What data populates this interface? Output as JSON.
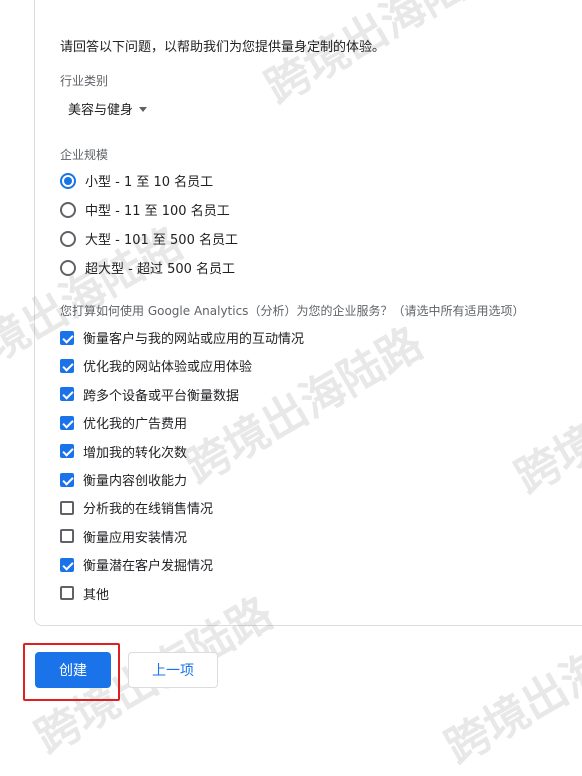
{
  "intro": "请回答以下问题，以帮助我们为您提供量身定制的体验。",
  "industry": {
    "label": "行业类别",
    "value": "美容与健身"
  },
  "size": {
    "label": "企业规模",
    "options": [
      {
        "text": "小型 - 1 至 10 名员工",
        "selected": true
      },
      {
        "text": "中型 - 11 至 100 名员工",
        "selected": false
      },
      {
        "text": "大型 - 101 至 500 名员工",
        "selected": false
      },
      {
        "text": "超大型 - 超过 500 名员工",
        "selected": false
      }
    ]
  },
  "usage": {
    "label": "您打算如何使用 Google Analytics（分析）为您的企业服务？（请选中所有适用选项）",
    "options": [
      {
        "text": "衡量客户与我的网站或应用的互动情况",
        "checked": true
      },
      {
        "text": "优化我的网站体验或应用体验",
        "checked": true
      },
      {
        "text": "跨多个设备或平台衡量数据",
        "checked": true
      },
      {
        "text": "优化我的广告费用",
        "checked": true
      },
      {
        "text": "增加我的转化次数",
        "checked": true
      },
      {
        "text": "衡量内容创收能力",
        "checked": true
      },
      {
        "text": "分析我的在线销售情况",
        "checked": false
      },
      {
        "text": "衡量应用安装情况",
        "checked": false
      },
      {
        "text": "衡量潜在客户发掘情况",
        "checked": true
      },
      {
        "text": "其他",
        "checked": false
      }
    ]
  },
  "buttons": {
    "create": "创建",
    "previous": "上一项"
  },
  "watermark": "跨境出海陆路",
  "colors": {
    "accent": "#1a73e8",
    "highlight": "#e02020"
  }
}
